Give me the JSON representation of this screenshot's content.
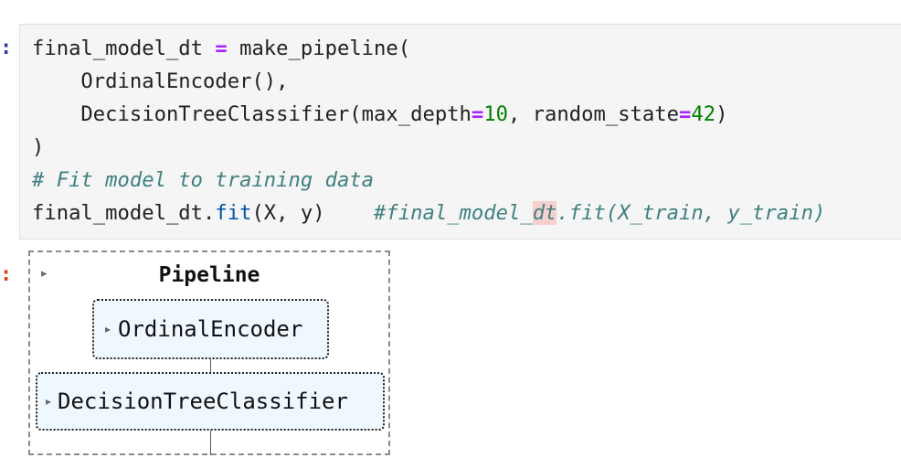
{
  "prompts": {
    "input": ":",
    "output": ":"
  },
  "code": {
    "line1": {
      "var": "final_model_dt",
      "op": "=",
      "call": "make_pipeline("
    },
    "line2": {
      "text": "    OrdinalEncoder(),"
    },
    "line3": {
      "pre": "    DecisionTreeClassifier(max_depth",
      "op1": "=",
      "num1": "10",
      "mid": ", random_state",
      "op2": "=",
      "num2": "42",
      "close": ")"
    },
    "line4": {
      "text": ")"
    },
    "line5": {
      "comment": "# Fit model to training data"
    },
    "line6": {
      "obj": "final_model_dt.",
      "method": "fit",
      "args": "(X, y)",
      "gap": "    ",
      "comment_pre": "#final_model_",
      "comment_highlight": "dt",
      "comment_post": ".fit(X_train, y_train)"
    }
  },
  "pipeline": {
    "title": "Pipeline",
    "toggle_icon": "triangle-right",
    "steps": [
      {
        "label": "OrdinalEncoder"
      },
      {
        "label": "DecisionTreeClassifier"
      }
    ]
  },
  "colors": {
    "operator": "#aa22ff",
    "number": "#008000",
    "function": "#0055aa",
    "comment": "#408080",
    "highlight": "#f6cfcf",
    "step_background": "#f0f8ff"
  }
}
